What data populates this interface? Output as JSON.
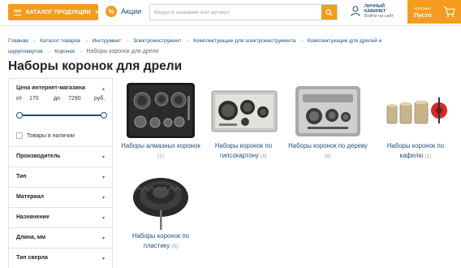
{
  "header": {
    "catalog_label": "КАТАЛОГ ПРОДУКЦИИ",
    "promo_label": "Акции",
    "promo_icon": "percent-icon",
    "search_placeholder": "Введите название или артикул",
    "account_line1": "ЛИЧНЫЙ",
    "account_line2": "КАБИНЕТ",
    "account_line3": "Войти на сайт",
    "cart_label": "КОРЗИНА",
    "cart_status": "Пусто",
    "accent_color": "#f39c1f",
    "brand_color": "#1e4f7a"
  },
  "breadcrumbs": {
    "items": [
      "Главная",
      "Каталог товаров",
      "Инструмент",
      "Электроинструмент",
      "Комплектующие для электроинструмента",
      "Комплектующие для дрелей и шуруповертов",
      "Коронки"
    ],
    "current": "Наборы коронок для дрели"
  },
  "page_title": "Наборы коронок для дрели",
  "sidebar": {
    "price_title": "Цена интернет-магазина",
    "from_label": "от",
    "min_price": "170",
    "to_label": "до",
    "max_price": "7290",
    "currency": "руб.",
    "in_stock_label": "Товары в наличии",
    "filters": [
      "Производитель",
      "Тип",
      "Материал",
      "Назначение",
      "Длина, мм",
      "Тип сверла"
    ]
  },
  "products": [
    {
      "name": "Наборы алмазных коронок",
      "count": "(1)"
    },
    {
      "name": "Наборы коронок по гипсокартону",
      "count": "(6)"
    },
    {
      "name": "Наборы коронок по дереву",
      "count": "(6)"
    },
    {
      "name": "Наборы коронок по кафелю",
      "count": "(1)"
    },
    {
      "name": "Наборы коронок по пластику",
      "count": "(6)"
    }
  ]
}
